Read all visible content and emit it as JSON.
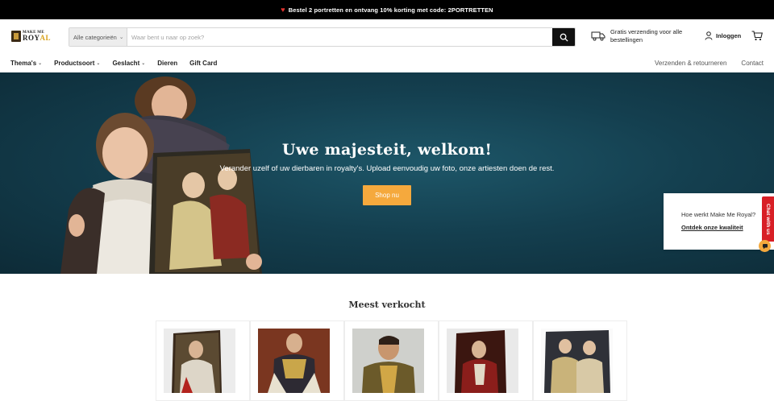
{
  "announcement": {
    "text": "Bestel 2 portretten en ontvang 10% korting met code: 2PORTRETTEN"
  },
  "logo": {
    "line1": "MAKE ME",
    "line2a": "ROY",
    "line2b": "AL"
  },
  "search": {
    "category": "Alle categorieën",
    "placeholder": "Waar bent u naar op zoek?"
  },
  "shipping": {
    "text": "Gratis verzending voor alle bestellingen"
  },
  "account": {
    "login": "Inloggen"
  },
  "nav": {
    "items": [
      {
        "label": "Thema's",
        "dropdown": true
      },
      {
        "label": "Productsoort",
        "dropdown": true
      },
      {
        "label": "Geslacht",
        "dropdown": true
      },
      {
        "label": "Dieren",
        "dropdown": false
      },
      {
        "label": "Gift Card",
        "dropdown": false
      }
    ],
    "right": [
      "Verzenden & retourneren",
      "Contact"
    ]
  },
  "hero": {
    "title": "Uwe majesteit, welkom!",
    "subtitle": "Verander uzelf of uw dierbaren in royalty's. Upload eenvoudig uw foto, onze artiesten doen de rest.",
    "cta": "Shop nu"
  },
  "popup": {
    "question": "Hoe werkt Make Me Royal?",
    "link": "Ontdek onze kwaliteit"
  },
  "chat": {
    "label": "Chat with us"
  },
  "bestsellers": {
    "title": "Meest verkocht"
  },
  "colors": {
    "accent": "#f5a93d",
    "hero_bg": "#143f4f",
    "announce_bg": "#000000",
    "chat_red": "#d81f26"
  },
  "icons": [
    "heart-icon",
    "chevron-down-icon",
    "search-icon",
    "truck-icon",
    "user-icon",
    "cart-icon",
    "chat-icon"
  ]
}
